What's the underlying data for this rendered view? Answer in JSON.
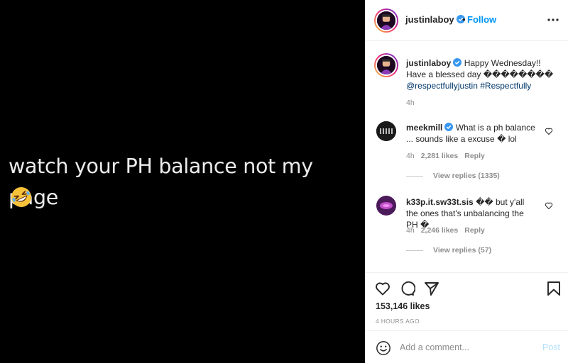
{
  "media": {
    "caption_line": "watch your PH balance not my page",
    "emoji_icon": "rolling-on-floor-laughing-emoji"
  },
  "header": {
    "username": "justinlaboy",
    "separator": "•",
    "follow_label": "Follow",
    "more_icon": "more-horizontal-icon"
  },
  "caption": {
    "username": "justinlaboy",
    "text": "Happy Wednesday!! Have a blessed day ��������",
    "mention": "@respectfullyjustin",
    "hashtag": "#Respectfully",
    "age": "4h"
  },
  "comments": [
    {
      "username": "meekmill",
      "text": "What is a ph balance ... sounds like a excuse � lol",
      "age": "4h",
      "likes": "2,281 likes",
      "reply_label": "Reply",
      "view_replies": "View replies (1335)"
    },
    {
      "username": "k33p.it.sw33t.sis",
      "text": "�� but y'all the ones that's unbalancing the PH �",
      "age": "4h",
      "likes": "2,246 likes",
      "reply_label": "Reply",
      "view_replies": "View replies (57)"
    }
  ],
  "actions": {
    "likes": "153,146 likes",
    "posted": "4 HOURS AGO"
  },
  "composer": {
    "placeholder": "Add a comment...",
    "post_label": "Post"
  },
  "colors": {
    "link_blue": "#0095f6",
    "verified_blue": "#3897f0",
    "muted": "#8e8e8e"
  }
}
